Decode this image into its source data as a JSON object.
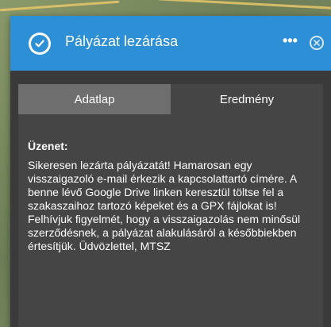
{
  "dialog": {
    "title": "Pályázat lezárása",
    "more_label": "•••",
    "icons": {
      "title": "check-circle-icon",
      "close": "close-circle-icon"
    }
  },
  "tabs": [
    {
      "label": "Adatlap",
      "active": false
    },
    {
      "label": "Eredmény",
      "active": true
    }
  ],
  "message": {
    "label": "Üzenet:",
    "body": "Sikeresen lezárta pályázatát! Hamarosan egy visszaigazoló e-mail érkezik a kapcsolattartó címére. A benne lévő Google Drive linken keresztül töltse fel a szakaszaihoz tartozó képeket és a GPX fájlokat is! Felhívjuk figyelmét, hogy a visszaigazolás nem minősül szerződésnek, a pályázat alakulásáról a későbbiekben értesítjük. Üdvözlettel, MTSZ"
  },
  "colors": {
    "titlebar": "#2d8fd6",
    "tab_inactive": "#6e6e6e",
    "tab_active": "#454545",
    "panel": "#3a3a3a"
  }
}
